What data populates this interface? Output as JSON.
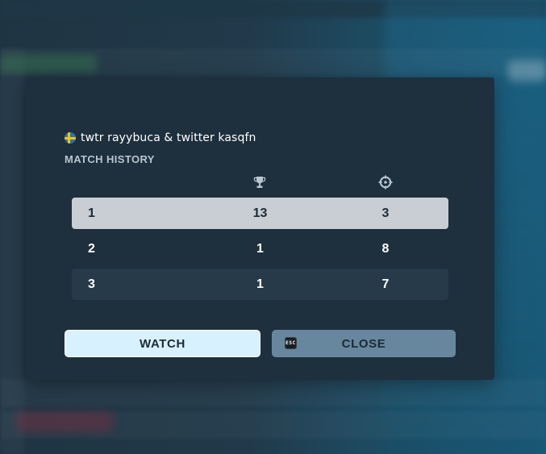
{
  "dialog": {
    "player_flag": "sweden-flag-icon",
    "player_name": "twtr rayybuca & twitter kasqfn",
    "section_title": "MATCH HISTORY",
    "columns": [
      {
        "icon": "row-number",
        "label": ""
      },
      {
        "icon": "trophy-icon",
        "label": ""
      },
      {
        "icon": "crosshair-icon",
        "label": ""
      }
    ],
    "rows": [
      {
        "index": "1",
        "placement": "13",
        "eliminations": "3",
        "selected": true
      },
      {
        "index": "2",
        "placement": "1",
        "eliminations": "8",
        "selected": false
      },
      {
        "index": "3",
        "placement": "1",
        "eliminations": "7",
        "selected": false
      }
    ],
    "buttons": {
      "watch_label": "WATCH",
      "close_label": "CLOSE",
      "close_key_icon": "esc-key-icon",
      "close_key_text": "ESC"
    }
  },
  "colors": {
    "modal_bg": "#1e2f3d",
    "selected_row_bg": "#c9ced4",
    "alt_row_bg": "#263a49",
    "watch_button_bg": "#d8f1ff",
    "close_button_bg": "#67879e",
    "flag_blue": "#2f6fb5",
    "flag_yellow": "#f4c600"
  }
}
